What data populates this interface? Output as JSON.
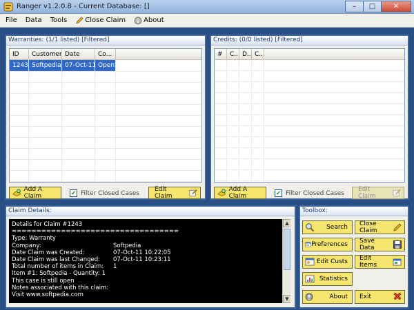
{
  "window": {
    "title": "Ranger v1.2.0.8 - Current Database: []",
    "minimize": "–",
    "maximize": "□",
    "close": "✕"
  },
  "menu": [
    "File",
    "Data",
    "Tools",
    "Close Claim",
    "About"
  ],
  "warranties": {
    "header": "Warranties: (1/1 listed) [Filtered]",
    "columns": [
      "ID",
      "Customer",
      "Date",
      "Co..."
    ],
    "rows": [
      {
        "id": "1243",
        "customer": "Softpedia",
        "date": "07-Oct-11",
        "status": "Open"
      }
    ],
    "add_button": "Add A Claim",
    "filter_label": "Filter Closed Cases",
    "edit_button": "Edit Claim"
  },
  "credits": {
    "header": "Credits: (0/0 listed) [Filtered]",
    "columns": [
      "#",
      "C...",
      "D...",
      "C..."
    ],
    "add_button": "Add A Claim",
    "filter_label": "Filter Closed Cases",
    "edit_button": "Edit Claim"
  },
  "claim_details": {
    "header": "Claim Details:",
    "lines": [
      {
        "label": "Details for Claim #1243",
        "value": ""
      },
      {
        "label": "==================================",
        "value": ""
      },
      {
        "label": "Type: Warranty",
        "value": ""
      },
      {
        "label": "Company:",
        "value": "Softpedia"
      },
      {
        "label": "Date Claim was Created:",
        "value": "07-Oct-11 10:22:05"
      },
      {
        "label": "Date Claim was last Changed:",
        "value": "07-Oct-11 10:23:11"
      },
      {
        "label": "Total number of items in Claim:",
        "value": "1"
      },
      {
        "label": "Item #1: Softpedia - Quantity: 1",
        "value": ""
      },
      {
        "label": "This case is still open",
        "value": ""
      },
      {
        "label": "Notes associated with this claim:",
        "value": ""
      },
      {
        "label": "Visit www.softpedia.com",
        "value": ""
      }
    ]
  },
  "toolbox": {
    "header": "Toolbox:",
    "buttons": {
      "search": "Search",
      "close_claim": "Close Claim",
      "preferences": "Preferences",
      "save_data": "Save Data",
      "edit_custs": "Edit Custs",
      "edit_items": "Edit Items",
      "statistics": "Statistics",
      "about": "About",
      "exit": "Exit"
    }
  },
  "colors": {
    "background": "#2a4f86",
    "button": "#f5e56f",
    "selection": "#3168c6"
  }
}
